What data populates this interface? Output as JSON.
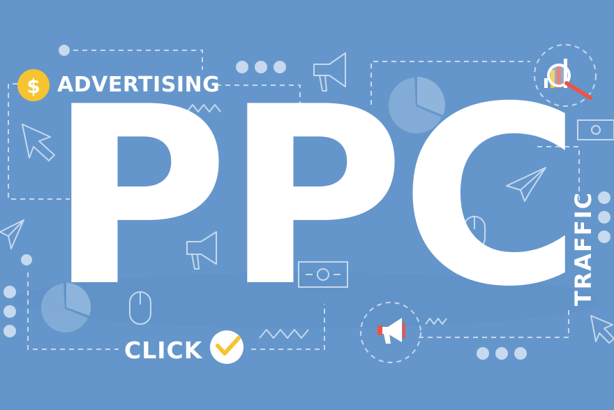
{
  "headline": {
    "text": "PPC"
  },
  "labels": {
    "advertising": "ADVERTISING",
    "click": "CLICK",
    "traffic": "TRAFFIC"
  },
  "colors": {
    "background": "#6596cb",
    "text": "#ffffff",
    "accent_yellow": "#f5c430",
    "accent_red": "#e9564a",
    "line": "#c6d9ee"
  },
  "icons": [
    "dollar-coin-icon",
    "checkmark-circle-icon",
    "megaphone-icon",
    "magnifier-chart-icon",
    "pie-chart-icon",
    "cursor-arrow-icon",
    "paper-plane-icon",
    "computer-mouse-icon",
    "banknote-icon",
    "zigzag-line-icon",
    "dot-cluster-icon"
  ]
}
